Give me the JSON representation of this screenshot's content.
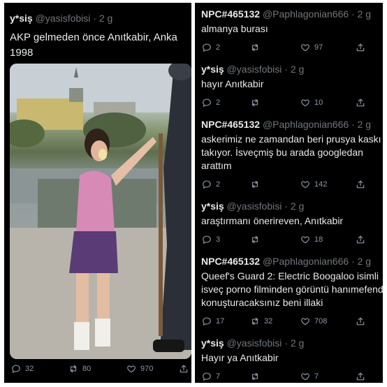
{
  "left": {
    "tweet": {
      "name": "y*siş",
      "handle": "@yasisfobisi",
      "dot": "·",
      "time": "2 g",
      "text_line1": "AKP gelmeden önce Anıtkabir, Anka",
      "text_line2": "1998",
      "replies": "32",
      "retweets": "80",
      "likes": "970"
    }
  },
  "right": {
    "tweets": [
      {
        "name": "NPC#465132",
        "handle": "@Paphlagonian666",
        "dot": "·",
        "time": "2 g",
        "lines": [
          "almanya burası"
        ],
        "replies": "2",
        "retweets": "",
        "likes": "97"
      },
      {
        "name": "y*siş",
        "handle": "@yasisfobisi",
        "dot": "·",
        "time": "2 g",
        "lines": [
          "hayır Anıtkabir"
        ],
        "replies": "2",
        "retweets": "",
        "likes": "10"
      },
      {
        "name": "NPC#465132",
        "handle": "@Paphlagonian666",
        "dot": "·",
        "time": "2 g",
        "lines": [
          "askerimiz ne zamandan beri prusya kaskı",
          "takıyor. İsveçmiş bu arada googledan",
          "arattım"
        ],
        "replies": "2",
        "retweets": "",
        "likes": "142"
      },
      {
        "name": "y*siş",
        "handle": "@yasisfobisi",
        "dot": "·",
        "time": "2 g",
        "lines": [
          "araştırmanı önerireven, Anıtkabir"
        ],
        "replies": "3",
        "retweets": "",
        "likes": "18"
      },
      {
        "name": "NPC#465132",
        "handle": "@Paphlagonian666",
        "dot": "·",
        "time": "2 g",
        "lines": [
          "Queef's Guard 2: Electric Boogaloo isimli",
          "isveç porno filminden görüntü hanımefend",
          "konuşturacaksınız beni illaki"
        ],
        "replies": "17",
        "retweets": "32",
        "likes": "708"
      },
      {
        "name": "y*siş",
        "handle": "@yasisfobisi",
        "dot": "·",
        "time": "2 g",
        "lines": [
          "Hayır ya Anıtkabir"
        ],
        "replies": "7",
        "retweets": "",
        "likes": "7"
      }
    ]
  },
  "icons": [
    "reply-icon",
    "retweet-icon",
    "like-icon",
    "share-icon"
  ],
  "colors": {
    "background": "#000000",
    "text": "#e7e9ea",
    "muted": "#71767b",
    "divider": "#ffffff"
  }
}
